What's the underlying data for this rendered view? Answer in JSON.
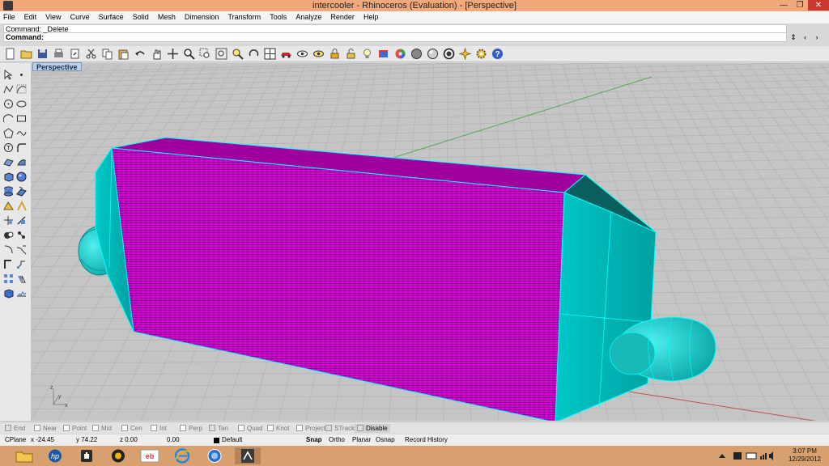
{
  "window": {
    "title": "intercooler - Rhinoceros (Evaluation) - [Perspective]",
    "min_glyph": "—",
    "max_glyph": "❐",
    "close_glyph": "✕"
  },
  "menu": [
    "File",
    "Edit",
    "View",
    "Curve",
    "Surface",
    "Solid",
    "Mesh",
    "Dimension",
    "Transform",
    "Tools",
    "Analyze",
    "Render",
    "Help"
  ],
  "command": {
    "history": "Command: _Delete",
    "prompt": "Command:",
    "buttons": [
      "⇕",
      "‹",
      "›"
    ]
  },
  "viewport": {
    "label": "Perspective",
    "axis_labels": {
      "x": "x",
      "y": "y",
      "z": "z"
    }
  },
  "toolbar_icons": [
    "new-icon",
    "open-icon",
    "save-icon",
    "print-icon",
    "import-icon",
    "cut-icon",
    "copy-icon",
    "paste-icon",
    "undo-icon",
    "pan-hand-icon",
    "move-view-icon",
    "zoom-icon",
    "zoom-window-icon",
    "zoom-extents-icon",
    "zoom-selected-icon",
    "rotate-view-icon",
    "viewports-icon",
    "car-render-icon",
    "hide-icon",
    "show-icon",
    "lock-icon",
    "unlock-icon",
    "light-bulb-icon",
    "layer-icon",
    "color-wheel-icon",
    "shaded-icon",
    "render-icon",
    "sphere-icon",
    "light-icon",
    "gear-icon",
    "help-icon"
  ],
  "osnaps": [
    {
      "label": "End",
      "checked": true
    },
    {
      "label": "Near",
      "checked": false
    },
    {
      "label": "Point",
      "checked": false
    },
    {
      "label": "Mid",
      "checked": false
    },
    {
      "label": "Cen",
      "checked": false
    },
    {
      "label": "Int",
      "checked": false
    },
    {
      "label": "Perp",
      "checked": false
    },
    {
      "label": "Tan",
      "checked": true
    },
    {
      "label": "Quad",
      "checked": false
    },
    {
      "label": "Knot",
      "checked": false
    },
    {
      "label": "Project",
      "checked": false
    },
    {
      "label": "STrack",
      "checked": false
    },
    {
      "label": "Disable",
      "checked": false
    }
  ],
  "status": {
    "cplane": "CPlane",
    "x": "x -24.45",
    "y": "y 74.22",
    "z": "z 0.00",
    "extra": "0.00",
    "layer": "Default",
    "toggles": [
      "Snap",
      "Ortho",
      "Planar",
      "Osnap",
      "Record History"
    ]
  },
  "taskbar": {
    "apps": [
      "file-explorer-icon",
      "hp-icon",
      "hand-app-icon",
      "media-player-icon",
      "ebay-icon",
      "internet-explorer-icon",
      "app-globe-icon",
      "rhino-icon"
    ],
    "time": "3:07 PM",
    "date": "12/29/2012"
  },
  "colors": {
    "core": "#cc00cc",
    "tank": "#00b4b4",
    "grid": "#b2b2b2",
    "titlebar": "#f1a87a",
    "taskbar": "#d9a06f"
  }
}
